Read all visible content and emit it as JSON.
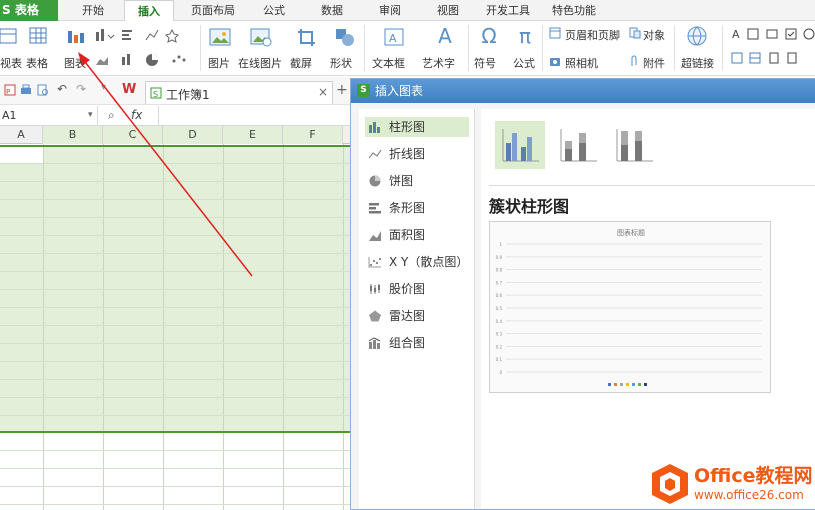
{
  "app": {
    "title": "S 表格"
  },
  "menu": {
    "tabs": [
      "开始",
      "插入",
      "页面布局",
      "公式",
      "数据",
      "审阅",
      "视图",
      "开发工具",
      "特色功能"
    ],
    "active": "插入"
  },
  "ribbon": {
    "left": {
      "prev": "视表",
      "table": "表格",
      "chart": "图表"
    },
    "picture": "图片",
    "online_picture": "在线图片",
    "screenshot": "截屏",
    "shapes": "形状",
    "textbox": "文本框",
    "wordart": "艺术字",
    "symbol": "符号",
    "formula": "公式",
    "header_footer": "页眉和页脚",
    "object": "对象",
    "camera": "照相机",
    "attachment": "附件",
    "hyperlink": "超链接"
  },
  "workbook": {
    "name": "工作簿1",
    "namebox": "A1",
    "fx": "fx",
    "columns": [
      "A",
      "B",
      "C",
      "D",
      "E",
      "F"
    ]
  },
  "dialog": {
    "title": "插入图表",
    "chart_types": [
      "柱形图",
      "折线图",
      "饼图",
      "条形图",
      "面积图",
      "X Y（散点图）",
      "股价图",
      "雷达图",
      "组合图"
    ],
    "selected_type": "柱形图",
    "subtype_title": "簇状柱形图",
    "preview": {
      "title": "图表标题",
      "yticks": [
        "1",
        "0.9",
        "0.8",
        "0.7",
        "0.6",
        "0.5",
        "0.4",
        "0.3",
        "0.2",
        "0.1",
        "0"
      ]
    }
  },
  "watermark": {
    "brand": "Office教程网",
    "url": "www.office26.com"
  },
  "colors": {
    "accent_green": "#3c9e3c",
    "selection_fill": "#e3efd8",
    "dialog_title": "#4a8ad0",
    "annotation_arrow": "#e02020",
    "logo_orange": "#f05a14"
  }
}
